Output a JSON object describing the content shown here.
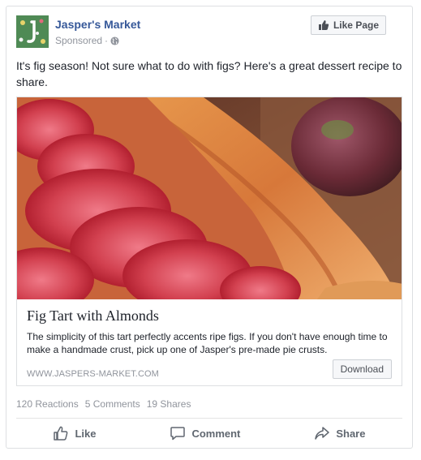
{
  "header": {
    "page_name": "Jasper's Market",
    "sponsored": "Sponsored",
    "separator": "·",
    "like_page": "Like Page"
  },
  "message": "It's fig season! Not sure what to do with figs? Here's a great dessert recipe to share.",
  "link": {
    "title": "Fig Tart with Almonds",
    "description": "The simplicity of this tart perfectly accents ripe figs. If you don't have enough time to make a handmade crust, pick up one of Jasper's pre-made pie crusts.",
    "domain": "WWW.JASPERS-MARKET.COM",
    "cta": "Download"
  },
  "stats": {
    "reactions": "120 Reactions",
    "comments": "5 Comments",
    "shares": "19 Shares"
  },
  "actions": {
    "like": "Like",
    "comment": "Comment",
    "share": "Share"
  },
  "colors": {
    "link_blue": "#365899",
    "meta_gray": "#90949c",
    "action_gray": "#606770"
  },
  "icons": [
    "page-avatar",
    "globe-icon",
    "thumbs-up-icon",
    "comment-icon",
    "share-icon"
  ]
}
